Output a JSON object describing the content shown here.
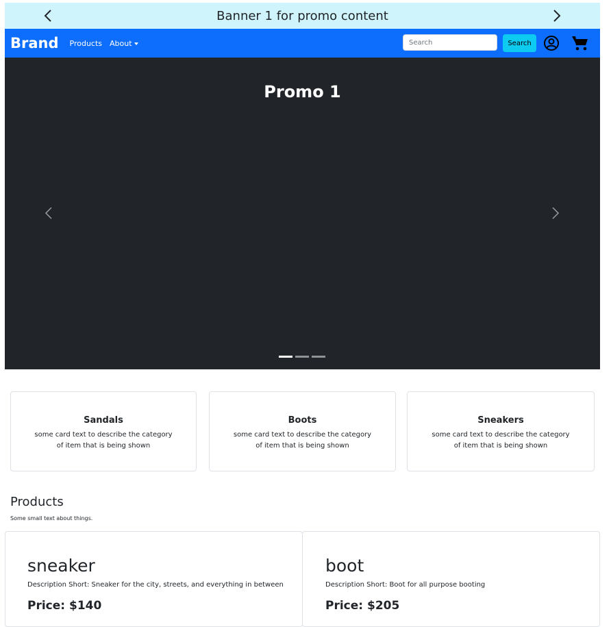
{
  "promo_bar": {
    "text": "Banner 1 for promo content",
    "background": "#cff4fc",
    "prev_icon": "chevron-left-icon",
    "next_icon": "chevron-right-icon"
  },
  "navbar": {
    "brand": "Brand",
    "links": [
      "Products",
      "About"
    ],
    "search_placeholder": "Search",
    "search_button": "Search",
    "user_icon": "user-circle-icon",
    "cart_icon": "cart-icon",
    "background": "#0d6efd",
    "search_button_color": "#0dcaf0"
  },
  "carousel": {
    "title": "Promo 1",
    "background": "#212529",
    "slide_count": 3,
    "active_slide": 1
  },
  "categories": [
    {
      "title": "Sandals",
      "text": "some card text to describe the category of item that is being shown"
    },
    {
      "title": "Boots",
      "text": "some card text to describe the category of item that is being shown"
    },
    {
      "title": "Sneakers",
      "text": "some card text to describe the category of item that is being shown"
    }
  ],
  "products": {
    "heading": "Products",
    "subtext": "Some small text about things.",
    "items": [
      {
        "name": "sneaker",
        "description": "Description Short: Sneaker for the city, streets, and everything in between",
        "price": "Price: $140"
      },
      {
        "name": "boot",
        "description": "Description Short: Boot for all purpose booting",
        "price": "Price: $205"
      }
    ]
  }
}
